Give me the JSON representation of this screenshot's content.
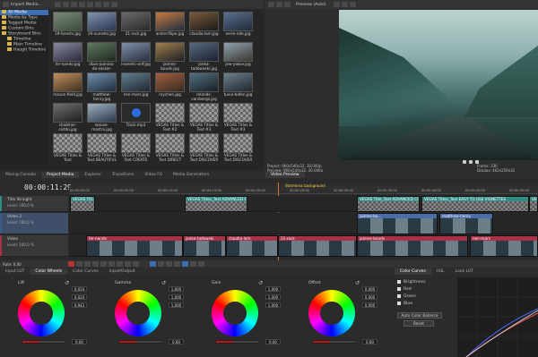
{
  "project_media": {
    "toolbar_label": "Import Media...",
    "tree": [
      {
        "label": "All Media",
        "selected": true
      },
      {
        "label": "Media by Type",
        "selected": false
      },
      {
        "label": "Tagged Media",
        "selected": false
      },
      {
        "label": "Custom Bins",
        "selected": false
      },
      {
        "label": "Storyboard Bins",
        "selected": false
      },
      {
        "label": "Timeline",
        "selected": false
      },
      {
        "label": "Main Timeline",
        "selected": false
      },
      {
        "label": "Haugit Timeline",
        "selected": false
      }
    ],
    "thumbs": [
      {
        "label": "19-forests.jpg",
        "c1": "#3b4a3a",
        "c2": "#7a8a7a"
      },
      {
        "label": "20-sunsets.jpg",
        "c1": "#2b3550",
        "c2": "#8094b0"
      },
      {
        "label": "21-rock.jpg",
        "c1": "#2a2a2a",
        "c2": "#6a6a6a"
      },
      {
        "label": "andre-filipe.jpg",
        "c1": "#203040",
        "c2": "#c87a40"
      },
      {
        "label": "claudia-lam.jpg",
        "c1": "#1a1a1a",
        "c2": "#7a5a3a"
      },
      {
        "label": "eerie-ride.jpg",
        "c1": "#202a38",
        "c2": "#5a7090"
      },
      {
        "label": "fer-nando.jpg",
        "c1": "#2a2a3a",
        "c2": "#8a8aa0"
      },
      {
        "label": "ilkan-juanieo-da-vassie-rcd/kis.jpg",
        "c1": "#1e2820",
        "c2": "#607a60"
      },
      {
        "label": "inonetic-arlf.jpg",
        "c1": "#283040",
        "c2": "#8090a8"
      },
      {
        "label": "jaimes-bouds.jpg",
        "c1": "#1f1f22",
        "c2": "#a08050"
      },
      {
        "label": "janka-tadowaski.jpg",
        "c1": "#1a2230",
        "c2": "#5a6a80"
      },
      {
        "label": "jew-yakov.jpg",
        "c1": "#3a3a30",
        "c2": "#90a0b0"
      },
      {
        "label": "mason-field.jpg",
        "c1": "#40301f",
        "c2": "#c09060"
      },
      {
        "label": "matthew-henry.jpg",
        "c1": "#1f2b3a",
        "c2": "#7090b0"
      },
      {
        "label": "nen-mars.jpg",
        "c1": "#20262f",
        "c2": "#608090"
      },
      {
        "label": "roychen.jpg",
        "c1": "#3a2a20",
        "c2": "#a06040"
      },
      {
        "label": "rolands-varsbergs.jpg",
        "c1": "#1a1f26",
        "c2": "#507080"
      },
      {
        "label": "tuvul-bafen.jpg",
        "c1": "#20262a",
        "c2": "#6a8090"
      },
      {
        "label": "shadmer-sistdo.jpg",
        "c1": "#1e1e1e",
        "c2": "#707070"
      },
      {
        "label": "wouse-mastra.jpg",
        "c1": "#2a3a4a",
        "c2": "#a0b0c0"
      },
      {
        "label": "Track.mp3",
        "c1": "#2b2b2b",
        "c2": "#2b2b2b"
      },
      {
        "label": "VEGAS Titles & Text #2",
        "c1": "#4a4a4a",
        "c2": "#8a8a8a"
      },
      {
        "label": "VEGAS Titles & Text #3",
        "c1": "#4a4a4a",
        "c2": "#8a8a8a"
      },
      {
        "label": "VEGAS Titles & Text #3",
        "c1": "#4a4a4a",
        "c2": "#8a8a8a"
      },
      {
        "label": "VEGAS Titles & Text ADVANCED COLO...",
        "c1": "#4a4a4a",
        "c2": "#8a8a8a"
      },
      {
        "label": "VEGAS Titles & Text BEAUTIFUL VIDE...",
        "c1": "#4a4a4a",
        "c2": "#8a8a8a"
      },
      {
        "label": "VEGAS Titles & Text CREATE YOUR O...",
        "c1": "#4a4a4a",
        "c2": "#8a8a8a"
      },
      {
        "label": "VEGAS Titles & Text DIRECT UPLOAD TO",
        "c1": "#4a4a4a",
        "c2": "#8a8a8a"
      },
      {
        "label": "VEGAS Titles & Text DISCOVER CREATE...",
        "c1": "#4a4a4a",
        "c2": "#8a8a8a"
      },
      {
        "label": "VEGAS Titles & Text DISCOVER CREATE...",
        "c1": "#4a4a4a",
        "c2": "#8a8a8a"
      }
    ],
    "bottom_tabs": [
      "Mixing Console",
      "Project Media",
      "Explorer",
      "Transitions",
      "Video FX",
      "Media Generators"
    ]
  },
  "preview": {
    "title": "Preview (Auto)",
    "info_left": [
      "Project:  960x540x32, 30,000p",
      "Preview:  960x540x32, 30,000p",
      "Display:  462x259x32"
    ],
    "info_right": [
      "Frame:  336",
      "Display:  462x259x32"
    ],
    "tab": "Video Preview"
  },
  "timeline": {
    "timecode": "00:00:11:29",
    "marker_label": "Storminss background",
    "ruler": [
      "00:00:00:00",
      "00:00:05:00",
      "00:00:10:00",
      "00:00:15:00",
      "00:00:20:00",
      "00:00:25:00",
      "00:00:30:00",
      "00:00:35:00",
      "00:00:40:00",
      "00:00:45:00",
      "00:00:50:00"
    ],
    "tracks": [
      {
        "name": "Title Straight",
        "level": "Level: 100,0 %"
      },
      {
        "name": "Video 2",
        "level": "Level: 100,0 %"
      },
      {
        "name": "Video",
        "level": "Level: 100,0 %"
      }
    ],
    "clips_top": [
      "VEGAS Titl...",
      "VEGAS Titles_Text ADVANCED CO...",
      "VEGAS Title_Text ADVANCED COLO...",
      "VEGAS Titles_Text EASY TO USE VIGNETTES",
      "VEGAS Titl..."
    ],
    "clips_mid": [
      "jaimes-bo...",
      "matthew-henry"
    ],
    "clips_bot": [
      "fer-nando",
      "janka-tadowski",
      "claudia-lam",
      "21-rock",
      "jaimes-bouds",
      "nen-mars"
    ],
    "rate": "Rate: 0,00"
  },
  "color": {
    "tabs": [
      "Input LUT",
      "Color Wheels",
      "Color Curves",
      "Input/Output"
    ],
    "wheels": [
      {
        "name": "Lift",
        "values": [
          "0,024",
          "0,024",
          "0,943"
        ],
        "slider": "0,00"
      },
      {
        "name": "Gamma",
        "values": [
          "1,000",
          "1,000",
          "1,000"
        ],
        "slider": "0,00"
      },
      {
        "name": "Gain",
        "values": [
          "1,000",
          "1,000",
          "1,000"
        ],
        "slider": "0,00"
      },
      {
        "name": "Offset",
        "values": [
          "0,000",
          "0,000",
          "0,000"
        ],
        "slider": "0,00"
      }
    ],
    "curves_tabs": [
      "Color Curves",
      "HSL",
      "Look LUT"
    ],
    "checks": [
      "Brightness",
      "Red",
      "Green",
      "Blue"
    ],
    "auto_label": "Auto Color Balance",
    "reset_label": "Reset"
  }
}
